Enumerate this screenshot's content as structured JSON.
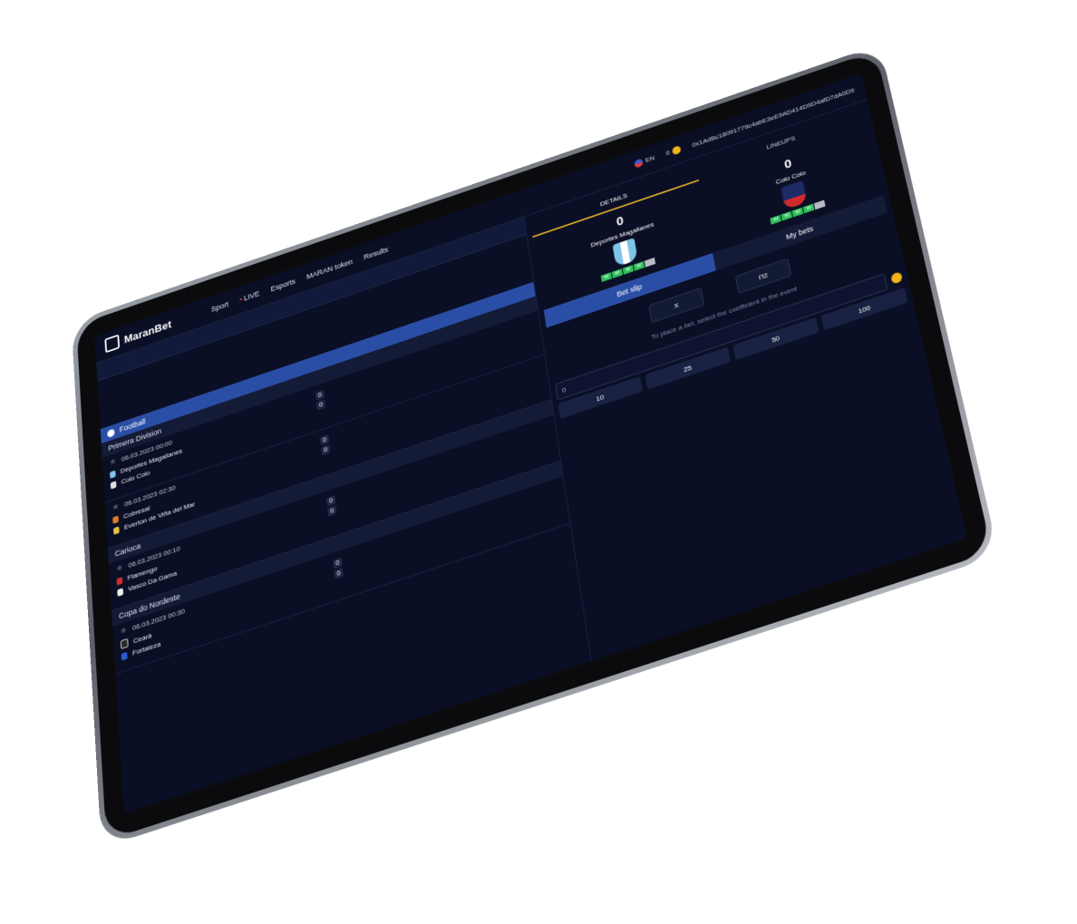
{
  "header": {
    "brand": "MaranBet",
    "nav": [
      "Sport",
      "LIVE",
      "Esports",
      "MARAN token",
      "Results"
    ],
    "language": "EN",
    "balance": "0",
    "wallet_address": "0x1AdBc18091779c4abE3eE9AD414D9D4afD7dA0D9"
  },
  "sport": "Football",
  "leagues": [
    {
      "name": "Primera Division",
      "matches": [
        {
          "date": "06.03.2023 00:00",
          "home": "Deportes Magallanes",
          "away": "Colo Colo",
          "home_score": "0",
          "away_score": "0"
        },
        {
          "date": "06.03.2023 02:30",
          "home": "Cobresal",
          "away": "Everton de Viña del Mar",
          "home_score": "0",
          "away_score": "0"
        }
      ]
    },
    {
      "name": "Carioca",
      "matches": [
        {
          "date": "06.03.2023 00:10",
          "home": "Flamengo",
          "away": "Vasco Da Gama",
          "home_score": "0",
          "away_score": "0"
        }
      ]
    },
    {
      "name": "Copa do Nordeste",
      "matches": [
        {
          "date": "06.03.2023 00:30",
          "home": "Ceará",
          "away": "Fortaleza",
          "home_score": "0",
          "away_score": "0"
        }
      ]
    }
  ],
  "event": {
    "tabs": [
      "DETAILS",
      "LINEUPS"
    ],
    "home": {
      "name": "Deportes Magallanes",
      "score": "0",
      "form": [
        "W",
        "W",
        "W",
        "W",
        ""
      ]
    },
    "away": {
      "name": "Colo Colo",
      "score": "0",
      "form": [
        "W",
        "W",
        "W",
        "W",
        ""
      ]
    }
  },
  "slip": {
    "tabs": [
      "Bet slip",
      "My bets"
    ],
    "odds": [
      "X",
      "П2"
    ],
    "hint": "To place a bet, select the coefficient in the event",
    "amount": "0",
    "stakes": [
      "10",
      "25",
      "50",
      "100"
    ]
  },
  "colors": {
    "accent": "#2a4ea6",
    "gold": "#d6a42a",
    "win": "#2dbf5a",
    "bg": "#0b0f25"
  }
}
